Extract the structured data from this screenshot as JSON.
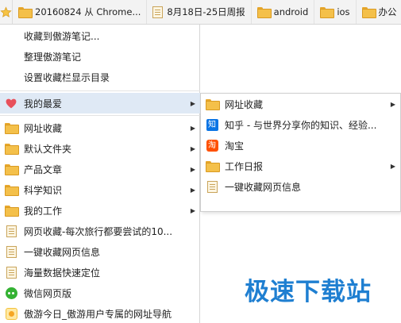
{
  "bookmarks_bar": {
    "items": [
      {
        "icon": "folder-icon",
        "label": "20160824 从 Chrome..."
      },
      {
        "icon": "page-icon",
        "label": "8月18日-25日周报"
      },
      {
        "icon": "folder-icon",
        "label": "android"
      },
      {
        "icon": "folder-icon",
        "label": "ios"
      },
      {
        "icon": "folder-icon",
        "label": "办公"
      }
    ]
  },
  "menu": {
    "actions": [
      {
        "label": "收藏到傲游笔记..."
      },
      {
        "label": "整理傲游笔记"
      },
      {
        "label": "设置收藏栏显示目录"
      }
    ],
    "favorites": {
      "icon": "heart-icon",
      "label": "我的最爱"
    },
    "items": [
      {
        "icon": "folder-icon",
        "label": "网址收藏",
        "submenu": true
      },
      {
        "icon": "folder-icon",
        "label": "默认文件夹",
        "submenu": true
      },
      {
        "icon": "folder-icon",
        "label": "产品文章",
        "submenu": true
      },
      {
        "icon": "folder-icon",
        "label": "科学知识",
        "submenu": true
      },
      {
        "icon": "folder-icon",
        "label": "我的工作",
        "submenu": true
      },
      {
        "icon": "page-icon",
        "label": "网页收藏-每次旅行都要尝试的10..."
      },
      {
        "icon": "page-icon",
        "label": "一键收藏网页信息"
      },
      {
        "icon": "page-icon",
        "label": "海量数据快速定位"
      },
      {
        "icon": "wechat-icon",
        "label": "微信网页版"
      },
      {
        "icon": "sun-icon",
        "label": "傲游今日_傲游用户专属的网址导航"
      }
    ]
  },
  "submenu": {
    "items": [
      {
        "icon": "folder-icon",
        "label": "网址收藏",
        "submenu": true
      },
      {
        "icon": "zhihu-icon",
        "glyph": "知",
        "label": "知乎 - 与世界分享你的知识、经验..."
      },
      {
        "icon": "taobao-icon",
        "glyph": "淘",
        "label": "淘宝"
      },
      {
        "icon": "folder-icon",
        "label": "工作日报",
        "submenu": true
      },
      {
        "icon": "page-icon",
        "label": "一键收藏网页信息"
      }
    ]
  },
  "arrow_glyph": "▶",
  "watermark": "极速下载站",
  "colors": {
    "highlight": "#dfe9f5",
    "folder": "#f4c04a",
    "heart": "#e8505b",
    "zhihu": "#0a74e4",
    "taobao": "#ff5000",
    "watermark": "#1f7fd1"
  }
}
